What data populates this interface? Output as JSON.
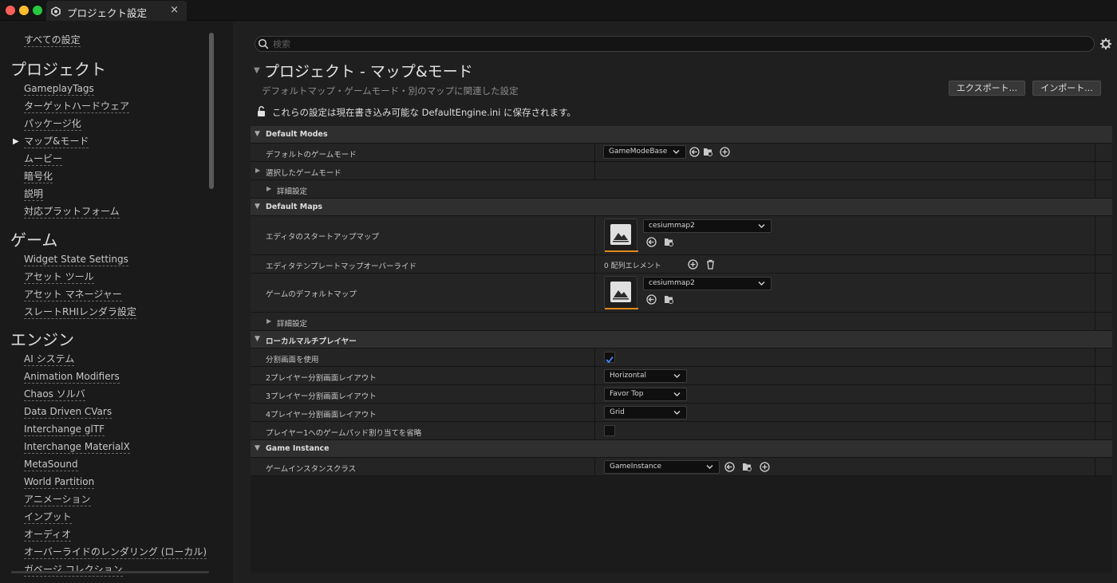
{
  "window": {
    "tab_title": "プロジェクト設定",
    "close_glyph": "×"
  },
  "sidebar": {
    "all_settings": "すべての設定",
    "categories": [
      {
        "name": "プロジェクト",
        "items": [
          "GameplayTags",
          "ターゲットハードウェア",
          "パッケージ化",
          "マップ&モード",
          "ムービー",
          "暗号化",
          "説明",
          "対応プラットフォーム"
        ],
        "selected": "マップ&モード"
      },
      {
        "name": "ゲーム",
        "items": [
          "Widget State Settings",
          "アセット ツール",
          "アセット マネージャー",
          "スレートRHIレンダラ設定"
        ]
      },
      {
        "name": "エンジン",
        "items": [
          "AI システム",
          "Animation Modifiers",
          "Chaos ソルバ",
          "Data Driven CVars",
          "Interchange glTF",
          "Interchange MaterialX",
          "MetaSound",
          "World Partition",
          "アニメーション",
          "インプット",
          "オーディオ",
          "オーバーライドのレンダリング (ローカル)",
          "ガベージ コレクション"
        ]
      }
    ]
  },
  "main": {
    "search_placeholder": "検索",
    "title": "プロジェクト - マップ&モード",
    "subtitle": "デフォルトマップ・ゲームモード・別のマップに関連した設定",
    "export_label": "エクスポート...",
    "import_label": "インポート...",
    "save_note": "これらの設定は現在書き込み可能な DefaultEngine.ini に保存されます。"
  },
  "sections": {
    "default_modes": {
      "label": "Default Modes",
      "default_game_mode_label": "デフォルトのゲームモード",
      "default_game_mode_value": "GameModeBase",
      "selected_game_mode_label": "選択したゲームモード",
      "advanced_label": "詳細設定"
    },
    "default_maps": {
      "label": "Default Maps",
      "editor_startup_label": "エディタのスタートアップマップ",
      "editor_startup_value": "cesiummap2",
      "template_override_label": "エディタテンプレートマップオーバーライド",
      "template_override_value": "0 配列エレメント",
      "game_default_label": "ゲームのデフォルトマップ",
      "game_default_value": "cesiummap2",
      "advanced_label": "詳細設定"
    },
    "local_multiplayer": {
      "label": "ローカルマルチプレイヤー",
      "use_split_label": "分割画面を使用",
      "use_split_checked": true,
      "two_player_label": "2プレイヤー分割画面レイアウト",
      "two_player_value": "Horizontal",
      "three_player_label": "3プレイヤー分割画面レイアウト",
      "three_player_value": "Favor Top",
      "four_player_label": "4プレイヤー分割画面レイアウト",
      "four_player_value": "Grid",
      "skip_gamepad_label": "プレイヤー1へのゲームパッド割り当てを省略",
      "skip_gamepad_checked": false
    },
    "game_instance": {
      "label": "Game Instance",
      "class_label": "ゲームインスタンスクラス",
      "class_value": "GameInstance"
    }
  },
  "colors": {
    "accent_orange": "#e08a1a",
    "check_blue": "#3d8bff",
    "traffic_red": "#fe5f57",
    "traffic_yellow": "#febc2e",
    "traffic_green": "#28c840"
  }
}
